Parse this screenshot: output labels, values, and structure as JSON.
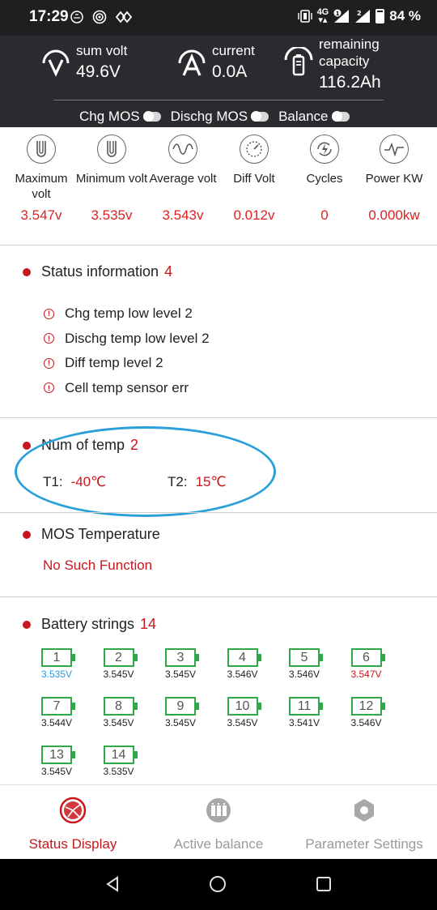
{
  "status_bar": {
    "time": "17:29",
    "network": "4G",
    "sim_badge": "1",
    "sim2": "2",
    "battery": "84 %"
  },
  "header": {
    "sum_volt": {
      "label": "sum volt",
      "value": "49.6V",
      "icon": "voltmeter-icon"
    },
    "current": {
      "label": "current",
      "value": "0.0A",
      "icon": "ammeter-icon"
    },
    "remaining": {
      "label_line1": "remaining",
      "label_line2": "capacity",
      "value": "116.2Ah",
      "icon": "battery-gauge-icon"
    },
    "switches": [
      {
        "label": "Chg MOS",
        "on": false
      },
      {
        "label": "Dischg MOS",
        "on": false
      },
      {
        "label": "Balance",
        "on": false
      }
    ]
  },
  "metrics": [
    {
      "label": "Maximum volt",
      "value": "3.547v",
      "icon": "max-volt-icon"
    },
    {
      "label": "Minimum volt",
      "value": "3.535v",
      "icon": "min-volt-icon"
    },
    {
      "label": "Average volt",
      "value": "3.543v",
      "icon": "sine-wave-icon"
    },
    {
      "label": "Diff Volt",
      "value": "0.012v",
      "icon": "gauge-icon"
    },
    {
      "label": "Cycles",
      "value": "0",
      "icon": "cycle-bolt-icon"
    },
    {
      "label": "Power KW",
      "value": "0.000kw",
      "icon": "power-pulse-icon"
    }
  ],
  "status_info": {
    "title": "Status information",
    "count": "4",
    "alerts": [
      "Chg temp low level 2",
      "Dischg temp low level 2",
      "Diff temp level 2",
      "Cell temp sensor err"
    ],
    "alert_icon_text": "!"
  },
  "temperature": {
    "title": "Num of temp",
    "count": "2",
    "t1_label": "T1:",
    "t1_value": "-40℃",
    "t2_label": "T2:",
    "t2_value": "15℃"
  },
  "mos_temperature": {
    "title": "MOS Temperature",
    "message": "No Such Function"
  },
  "battery_strings": {
    "title": "Battery strings",
    "count": "14",
    "cells": [
      {
        "id": "1",
        "volt": "3.535V",
        "state": "min"
      },
      {
        "id": "2",
        "volt": "3.545V",
        "state": "normal"
      },
      {
        "id": "3",
        "volt": "3.545V",
        "state": "normal"
      },
      {
        "id": "4",
        "volt": "3.546V",
        "state": "normal"
      },
      {
        "id": "5",
        "volt": "3.546V",
        "state": "normal"
      },
      {
        "id": "6",
        "volt": "3.547V",
        "state": "max"
      },
      {
        "id": "7",
        "volt": "3.544V",
        "state": "normal"
      },
      {
        "id": "8",
        "volt": "3.545V",
        "state": "normal"
      },
      {
        "id": "9",
        "volt": "3.545V",
        "state": "normal"
      },
      {
        "id": "10",
        "volt": "3.545V",
        "state": "normal"
      },
      {
        "id": "11",
        "volt": "3.541V",
        "state": "normal"
      },
      {
        "id": "12",
        "volt": "3.546V",
        "state": "normal"
      },
      {
        "id": "13",
        "volt": "3.545V",
        "state": "normal"
      },
      {
        "id": "14",
        "volt": "3.535V",
        "state": "normal"
      }
    ]
  },
  "bottom_nav": [
    {
      "label": "Status Display",
      "active": true,
      "icon": "status-display-icon"
    },
    {
      "label": "Active balance",
      "active": false,
      "icon": "active-balance-icon"
    },
    {
      "label": "Parameter Settings",
      "active": false,
      "icon": "parameter-settings-icon"
    }
  ],
  "colors": {
    "accent_red": "#c8161d",
    "cell_green": "#2fa84a",
    "min_cell_blue": "#2a9be0",
    "annotation_blue": "#2aa0d8"
  }
}
